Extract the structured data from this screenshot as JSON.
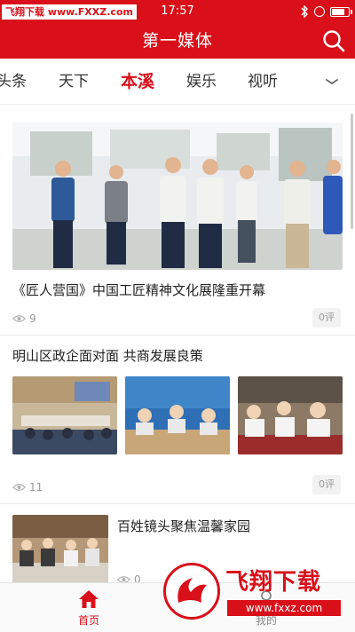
{
  "status_bar": {
    "watermark": "飞翔下载 www.FXXZ.com",
    "time": "17:57",
    "battery_level": 0.8
  },
  "header": {
    "title": "第一媒体",
    "search_icon": "search-icon"
  },
  "tabs": [
    {
      "label": "头条",
      "active": false
    },
    {
      "label": "天下",
      "active": false
    },
    {
      "label": "本溪",
      "active": true
    },
    {
      "label": "娱乐",
      "active": false
    },
    {
      "label": "视听",
      "active": false
    }
  ],
  "tabs_more_icon": "chevron-down-icon",
  "articles": [
    {
      "title": "《匠人营国》中国工匠精神文化展隆重开幕",
      "views": "9",
      "comments": "0评"
    },
    {
      "title": "明山区政企面对面  共商发展良策",
      "views": "11",
      "comments": "0评"
    },
    {
      "title": "百姓镜头聚焦温馨家园",
      "views": "0"
    }
  ],
  "bottom_nav": [
    {
      "label": "首页",
      "icon": "home-icon",
      "active": true
    },
    {
      "label": "我的",
      "icon": "person-icon",
      "active": false
    }
  ],
  "overlay_watermark": {
    "title": "飞翔下载",
    "url": "www.fxxz.com"
  },
  "colors": {
    "brand_red": "#d9101a",
    "text_dark": "#222222",
    "text_muted": "#999999"
  }
}
